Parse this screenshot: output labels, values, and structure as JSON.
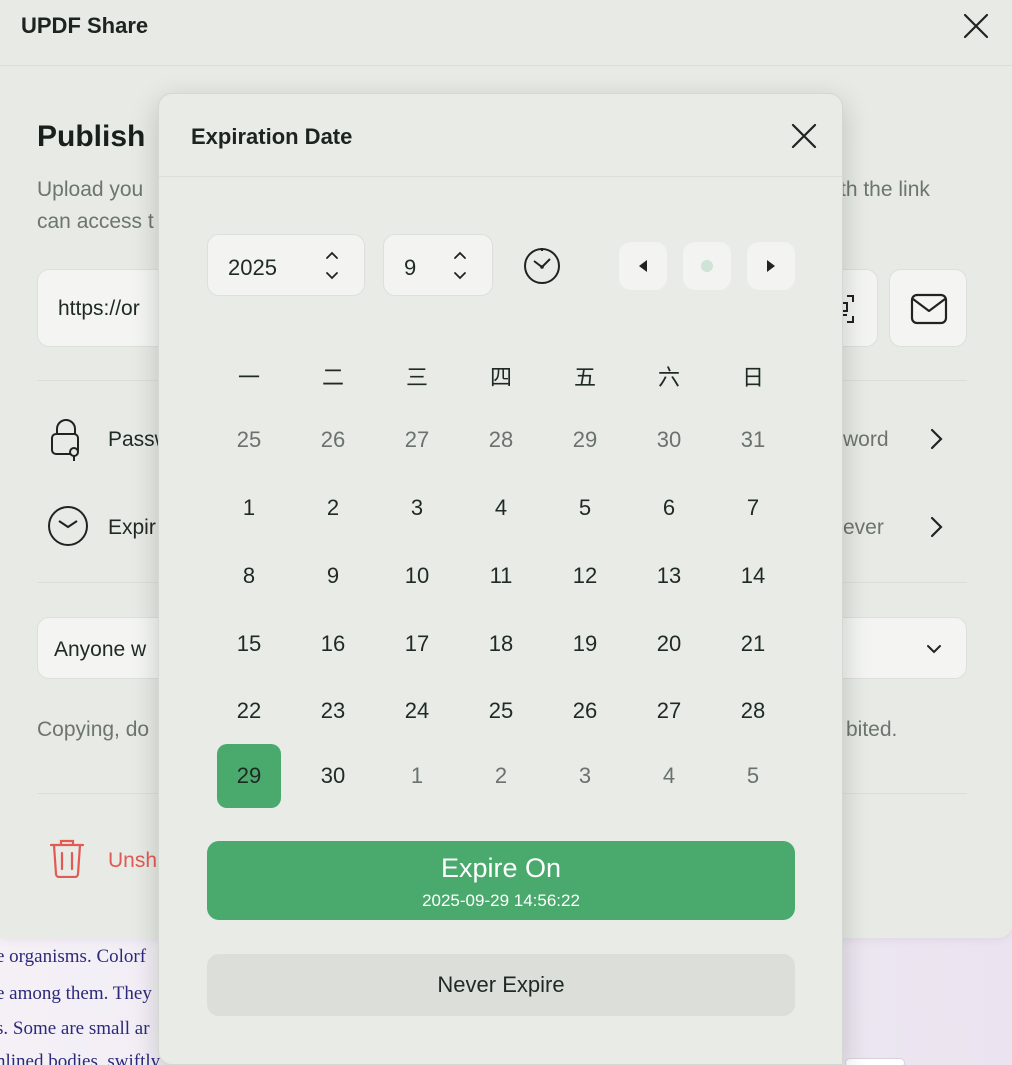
{
  "app": {
    "title": "UPDF Share"
  },
  "background_doc": {
    "lines": [
      "e organisms. Colorf",
      "e among them. They",
      "s. Some are small ar",
      "nlined bodies, swiftly"
    ]
  },
  "publish": {
    "title": "Publish",
    "desc_line1_start": "Upload you",
    "desc_line1_end": "th the link",
    "desc_line2_start": "can access t",
    "link_value": "https://or"
  },
  "settings": {
    "password_label": "Passw",
    "password_value": "word",
    "expire_label": "Expir",
    "expire_value": "ever"
  },
  "access": {
    "selected": "Anyone w",
    "restriction_start": "Copying, do",
    "restriction_end": "bited."
  },
  "unshare": {
    "label": "Unsh"
  },
  "popup": {
    "title": "Expiration Date",
    "year": "2025",
    "month": "9",
    "weekdays": [
      "一",
      "二",
      "三",
      "四",
      "五",
      "六",
      "日"
    ],
    "weeks": [
      [
        "25",
        "26",
        "27",
        "28",
        "29",
        "30",
        "31"
      ],
      [
        "1",
        "2",
        "3",
        "4",
        "5",
        "6",
        "7"
      ],
      [
        "8",
        "9",
        "10",
        "11",
        "12",
        "13",
        "14"
      ],
      [
        "15",
        "16",
        "17",
        "18",
        "19",
        "20",
        "21"
      ],
      [
        "22",
        "23",
        "24",
        "25",
        "26",
        "27",
        "28"
      ],
      [
        "29",
        "30",
        "1",
        "2",
        "3",
        "4",
        "5"
      ]
    ],
    "expire_on_label": "Expire On",
    "expire_on_datetime": "2025-09-29 14:56:22",
    "never_expire_label": "Never Expire"
  },
  "colors": {
    "accent": "#4aa96c",
    "danger": "#e35a55",
    "panel": "#e8ebe6"
  }
}
